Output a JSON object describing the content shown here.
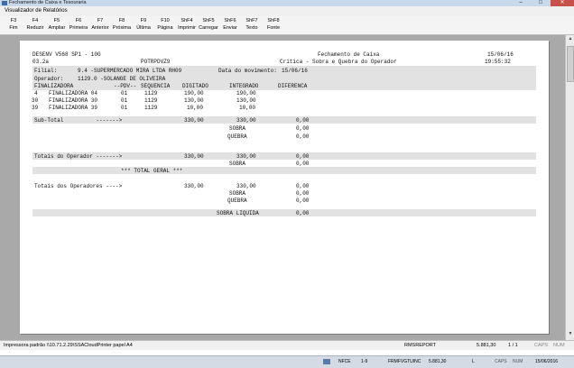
{
  "window": {
    "title": "Fechamento de Caixa e Tesouraria"
  },
  "menubar": {
    "label": "Visualizador de Relatórios"
  },
  "toolbar": [
    {
      "key": "F3",
      "label": "Fim",
      "icon": "exit-icon"
    },
    {
      "key": "F4",
      "label": "Reduzir",
      "icon": "zoom-out-icon"
    },
    {
      "key": "F5",
      "label": "Ampliar",
      "icon": "zoom-in-icon"
    },
    {
      "key": "F6",
      "label": "Primeira",
      "icon": "first-page-icon"
    },
    {
      "key": "F7",
      "label": "Anterior",
      "icon": "prev-page-icon"
    },
    {
      "key": "F8",
      "label": "Próxima",
      "icon": "next-page-icon"
    },
    {
      "key": "F9",
      "label": "Última",
      "icon": "last-page-icon"
    },
    {
      "key": "F10",
      "label": "Página",
      "icon": "goto-page-icon"
    },
    {
      "key": "ShF4",
      "label": "Imprimir",
      "icon": "print-icon"
    },
    {
      "key": "ShF5",
      "label": "Carregar",
      "icon": "load-icon"
    },
    {
      "key": "ShF6",
      "label": "Enviar",
      "icon": "send-icon"
    },
    {
      "key": "ShF7",
      "label": "Texto",
      "icon": "text-icon"
    },
    {
      "key": "ShF8",
      "label": "Fonte",
      "icon": "font-icon"
    }
  ],
  "report": {
    "header_left_1": "DESENV V568 SP1 - 10G",
    "header_left_2": "03.2a",
    "report_code": "POTRPDVZ9",
    "title_1": "Fechamento de Caixa",
    "title_2": "Crítica - Sobra e Quebra do Operador",
    "date": "15/06/16",
    "time": "19:55:32",
    "filial_label": "Filial:",
    "filial_value": "9.4 -SUPERMERCADO MIRA LTDA RH09",
    "movimento_label": "Data do movimento:",
    "movimento_value": "15/06/16",
    "operador_label": "Operador:",
    "operador_value": "1129.0 -SOLANGE DE OLIVEIRA",
    "columns": [
      "FINALIZADORA",
      "--PDV--",
      "SEQUENCIA",
      "DIGITADO",
      "INTEGRADO",
      "DIFERENCA"
    ],
    "rows": [
      {
        "num": "4",
        "name": "FINALIZADORA 04",
        "pdv": "01",
        "seq": "1129",
        "digitado": "190,00",
        "integrado": "190,00"
      },
      {
        "num": "30",
        "name": "FINALIZADORA 30",
        "pdv": "01",
        "seq": "1129",
        "digitado": "130,00",
        "integrado": "130,00"
      },
      {
        "num": "39",
        "name": "FINALIZADORA 39",
        "pdv": "01",
        "seq": "1129",
        "digitado": "10,00",
        "integrado": "10,00"
      }
    ],
    "subtotal_label": "Sub-Total          ------->",
    "subtotal_digitado": "330,00",
    "subtotal_integrado": "330,00",
    "subtotal_dif": "0,00",
    "sobra_label": "SOBRA",
    "quebra_label": "QUEBRA",
    "zero": "0,00",
    "tot_op_label": "Totais do Operador ------->",
    "tot_op_digitado": "330,00",
    "tot_op_integrado": "330,00",
    "total_geral_label": "*** TOTAL GERAL ***",
    "tot_ops_label": "Totais dos Operadores ---->",
    "tot_ops_digitado": "330,00",
    "tot_ops_integrado": "330,00",
    "sobra_liquida_label": "SOBRA LIQUIDA"
  },
  "statusbar": {
    "printer": "Impressora padrão \\\\10.71.2.29\\SSACloudPrinter papel A4",
    "report": "RMSREPORT",
    "value": "5.881,30",
    "page": "1 / 1",
    "caps": "CAPS",
    "num": "NUM"
  },
  "taskbar": {
    "item1": "NFCE",
    "item2": "1-9",
    "item3": "FRMFVGTUINC",
    "item4": "5.881,30",
    "item5": "L",
    "caps": "CAPS",
    "num": "NUM",
    "date": "15/06/2016"
  }
}
